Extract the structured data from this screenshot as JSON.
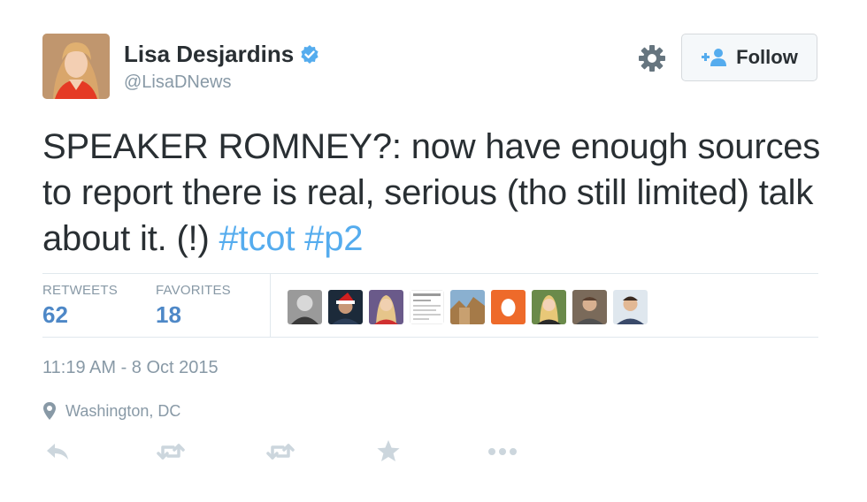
{
  "user": {
    "name": "Lisa Desjardins",
    "handle": "@LisaDNews",
    "verified_icon": "verified-badge-icon"
  },
  "actions_top": {
    "settings_icon": "gear-icon",
    "follow_label": "Follow",
    "follow_icon": "add-user-icon"
  },
  "tweet": {
    "text_main": "SPEAKER ROMNEY?: now have enough sources to report there is real, serious (tho still limited) talk about it. (!) ",
    "hashtag_1": "#tcot",
    "hashtag_2": "#p2"
  },
  "stats": {
    "retweets_label": "RETWEETS",
    "retweets_value": "62",
    "favorites_label": "FAVORITES",
    "favorites_value": "18"
  },
  "meta": {
    "timestamp": "11:19 AM - 8 Oct 2015",
    "location": "Washington, DC",
    "location_icon": "map-pin-icon"
  },
  "footer_actions": [
    "reply-icon",
    "retweet-icon",
    "retweet-icon",
    "favorite-star-icon",
    "more-icon"
  ],
  "colors": {
    "link_blue": "#55acee",
    "stat_blue": "#4e88c7",
    "gray_text": "#8899a6",
    "border": "#e1e8ed"
  }
}
